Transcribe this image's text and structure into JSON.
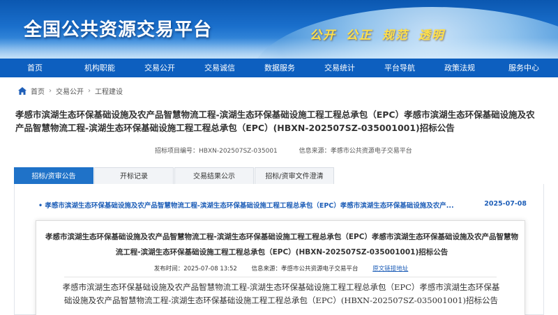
{
  "banner": {
    "title": "全国公共资源交易平台",
    "slogan": "公开 公正 规范 透明"
  },
  "nav": {
    "items": [
      "首页",
      "机构职能",
      "交易公开",
      "交易诚信",
      "数据服务",
      "交易统计",
      "平台导航",
      "政策法规",
      "服务中心"
    ]
  },
  "breadcrumb": {
    "home": "首页",
    "level1": "交易公开",
    "level2": "工程建设",
    "separator": "›"
  },
  "page_title": "孝感市滨湖生态环保基础设施及农产品智慧物流工程-滨湖生态环保基础设施工程工程总承包（EPC）孝感市滨湖生态环保基础设施及农产品智慧物流工程-滨湖生态环保基础设施工程工程总承包（EPC）(HBXN-202507SZ-035001001)招标公告",
  "meta": {
    "project_no_label": "招标项目编号：",
    "project_no": "HBXN-202507SZ-035001",
    "source_label": "信息来源：",
    "source": "孝感市公共资源电子交易平台"
  },
  "tabs": [
    "招标/资审公告",
    "开标记录",
    "交易结果公示",
    "招标/资审文件澄清"
  ],
  "list": {
    "link": "• 孝感市滨湖生态环保基础设施及农产品智慧物流工程-滨湖生态环保基础设施工程工程总承包（EPC）孝感市滨湖生态环保基础设施及农产...",
    "date": "2025-07-08"
  },
  "card": {
    "title": "孝感市滨湖生态环保基础设施及农产品智慧物流工程-滨湖生态环保基础设施工程工程总承包（EPC）孝感市滨湖生态环保基础设施及农产品智慧物流工程-滨湖生态环保基础设施工程工程总承包（EPC）(HBXN-202507SZ-035001001)招标公告",
    "publish_label": "发布时间：",
    "publish_time": "2025-07-08 13:52",
    "source_label": "信息来源：",
    "source": "孝感市公共资源电子交易平台",
    "original_link": "原文链接地址",
    "body": "孝感市滨湖生态环保基础设施及农产品智慧物流工程-滨湖生态环保基础设施工程工程总承包（EPC）孝感市滨湖生态环保基础设施及农产品智慧物流工程-滨湖生态环保基础设施工程工程总承包（EPC）(HBXN-202507SZ-035001001)招标公告"
  },
  "colors": {
    "nav_bg": "#0d5fbf",
    "active_tab": "#1f72c8",
    "link": "#1f5fb8",
    "slogan": "#ffe04a"
  }
}
